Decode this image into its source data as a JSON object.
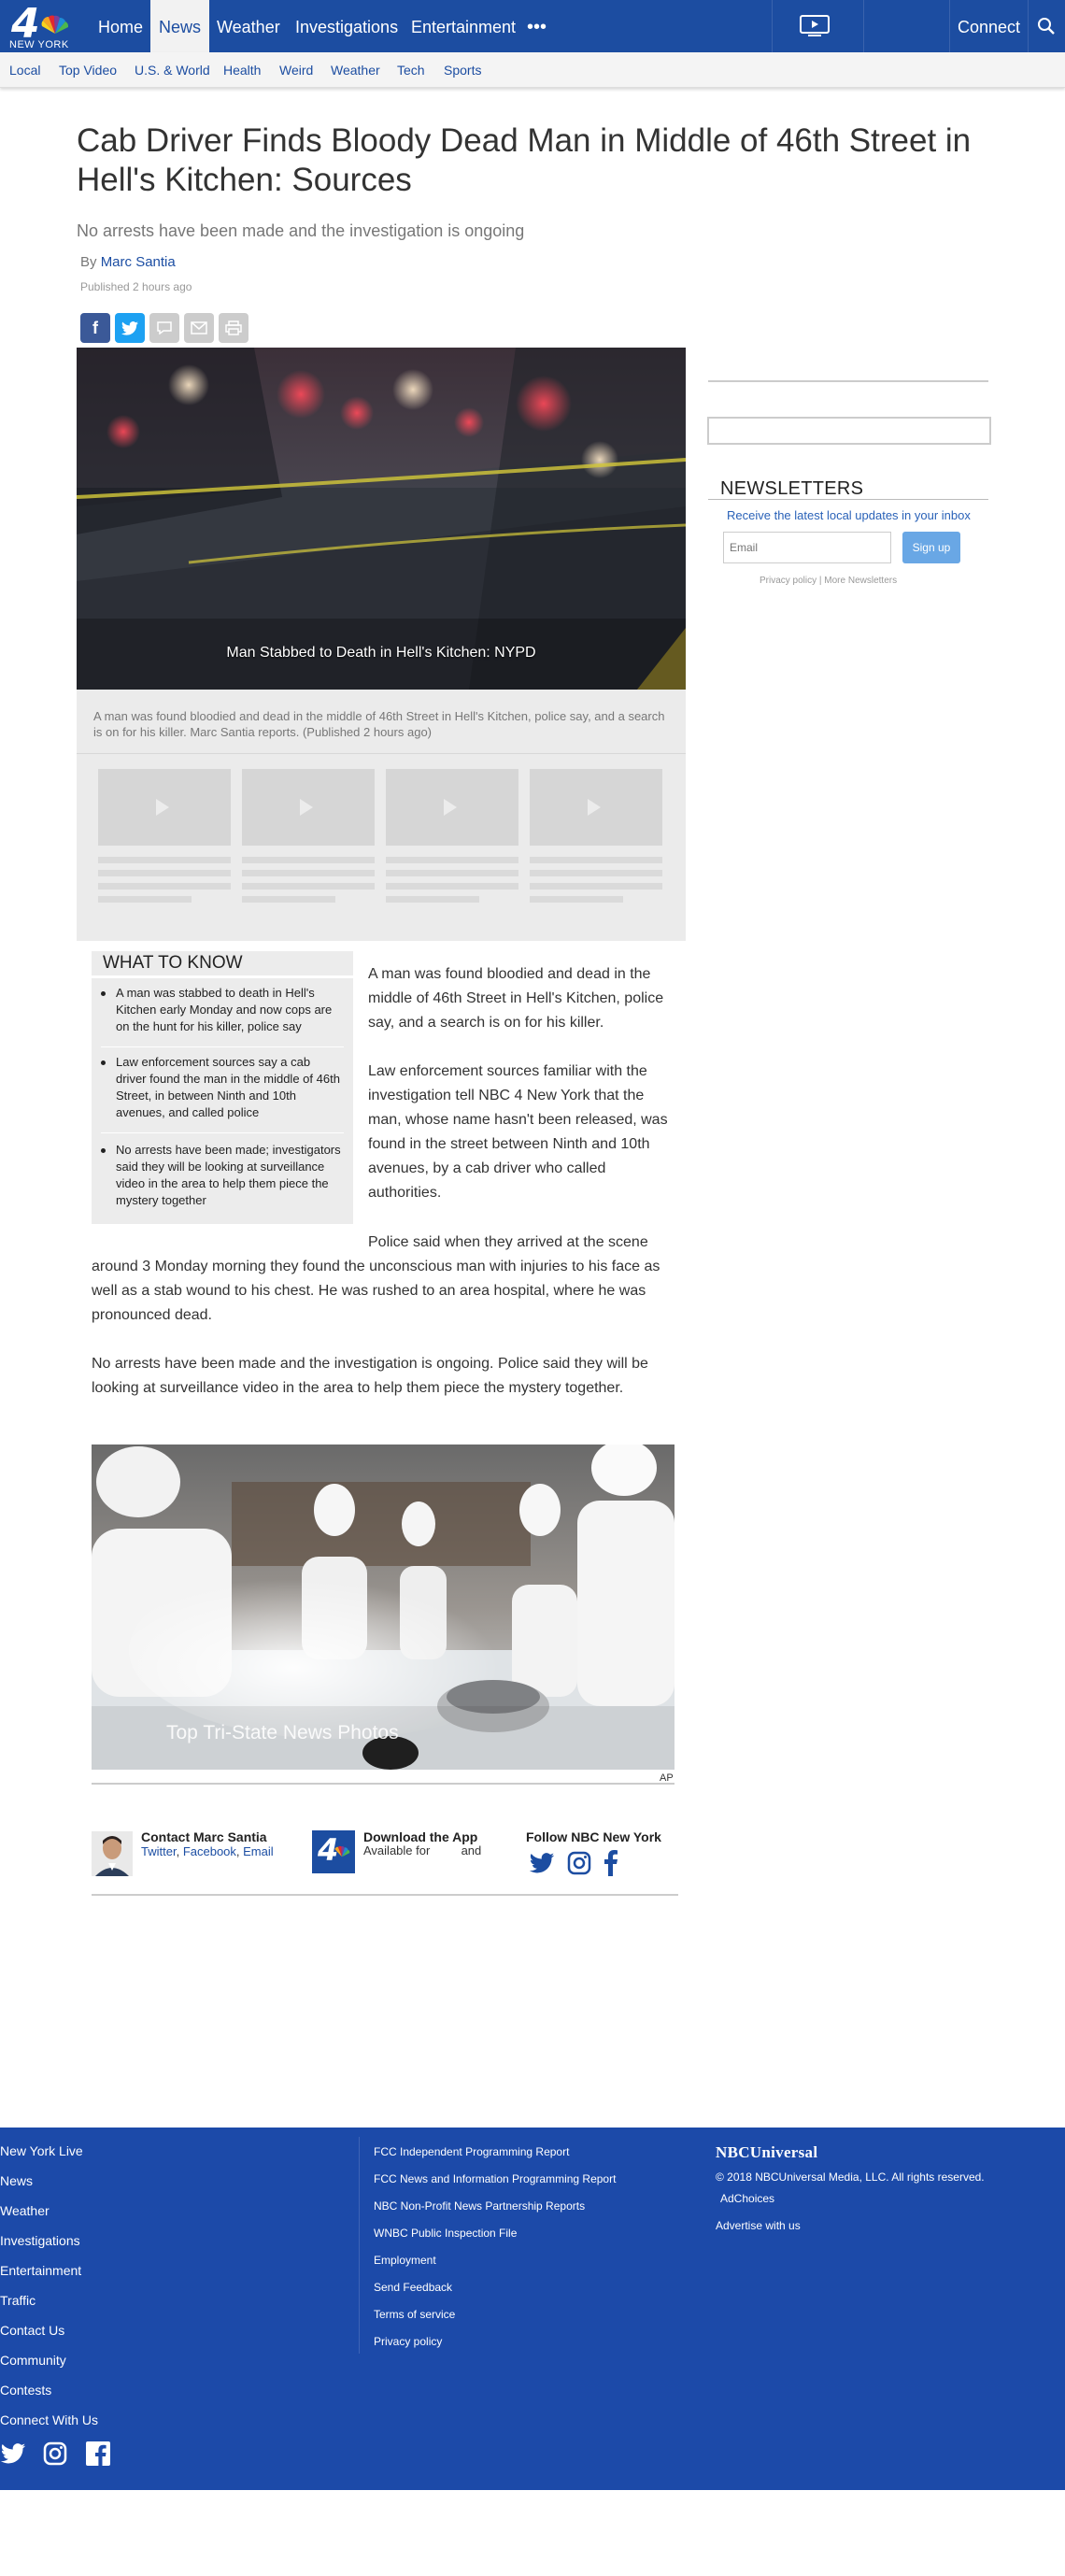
{
  "nav": {
    "logo_text": "NEW YORK",
    "logo_number": "4",
    "items": [
      "Home",
      "News",
      "Weather",
      "Investigations",
      "Entertainment"
    ],
    "active": "News",
    "more": "•••",
    "connect": "Connect"
  },
  "subnav": [
    "Local",
    "Top Video",
    "U.S. & World",
    "Health",
    "Weird",
    "Weather",
    "Tech",
    "Sports"
  ],
  "article": {
    "headline": "Cab Driver Finds Bloody Dead Man in Middle of 46th Street in Hell's Kitchen: Sources",
    "subhead": "No arrests have been made and the investigation is ongoing",
    "by": "By ",
    "author": "Marc Santia",
    "published": "Published 2 hours ago",
    "paragraphs": [
      "A man was found bloodied and dead in the middle of 46th Street in Hell's Kitchen, police say, and a search is on for his killer.",
      "Law enforcement sources familiar with the investigation tell NBC 4 New York that the man, whose name hasn't been released, was found in the street between Ninth and 10th avenues, by a cab driver who called authorities.",
      "Police said when they arrived at the scene around 3 Monday morning they found the unconscious man with injuries to his face as well as a stab wound to his chest. He was rushed to an area hospital, where he was pronounced dead.",
      "No arrests have been made and the investigation is ongoing. Police said they will be looking at surveillance video in the area to help them piece the mystery together."
    ]
  },
  "video": {
    "title": "Man Stabbed to Death in Hell's Kitchen: NYPD",
    "caption": "A man was found bloodied and dead in the middle of 46th Street in Hell's Kitchen, police say, and a search is on for his killer. Marc Santia reports. (Published 2 hours ago)"
  },
  "what_to_know": {
    "title": "WHAT TO KNOW",
    "items": [
      "A man was stabbed to death in Hell's Kitchen early Monday and now cops are on the hunt for his killer, police say",
      "Law enforcement sources say a cab driver found the man in the middle of 46th Street, in between Ninth and 10th avenues, and called police",
      "No arrests have been made; investigators said they will be looking at surveillance video in the area to help them piece the mystery together"
    ]
  },
  "gallery": {
    "title": "Top Tri-State News Photos",
    "credit": "AP"
  },
  "contact": {
    "title": "Contact Marc Santia",
    "links": [
      "Twitter",
      "Facebook",
      "Email"
    ],
    "app_title": "Download the App",
    "app_text": "Available for",
    "app_and": "and",
    "follow_title": "Follow NBC New York"
  },
  "newsletters": {
    "title": "NEWSLETTERS",
    "text": "Receive the latest local updates in your inbox",
    "placeholder": "Email",
    "button": "Sign up",
    "foot": "Privacy policy | More Newsletters"
  },
  "footer": {
    "left": [
      "New York Live",
      "News",
      "Weather",
      "Investigations",
      "Entertainment",
      "Traffic",
      "Contact Us",
      "Community",
      "Contests",
      "Connect With Us"
    ],
    "middle": [
      "FCC Independent Programming Report",
      "FCC News and Information Programming Report",
      "NBC Non-Profit News Partnership Reports",
      "WNBC Public Inspection File",
      "Employment",
      "Send Feedback",
      "Terms of service",
      "Privacy policy"
    ],
    "brand": "NBCUniversal",
    "copyright": "© 2018 NBCUniversal Media, LLC. All rights reserved.",
    "adchoices": "AdChoices",
    "advertise": "Advertise with us"
  },
  "colors": {
    "brand_blue": "#1c4da1",
    "footer_blue": "#1c4aa9",
    "link_blue": "#1c4ea3",
    "facebook": "#3b5998",
    "twitter": "#1da1f2"
  }
}
